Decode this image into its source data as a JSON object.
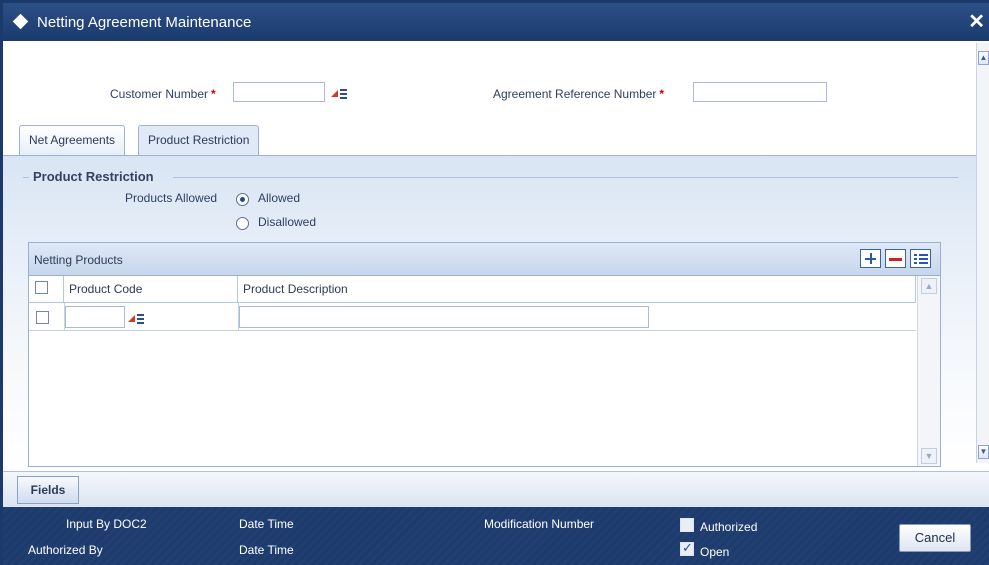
{
  "window": {
    "title": "Netting Agreement Maintenance",
    "close_icon": "close-icon"
  },
  "header": {
    "customer_number_label": "Customer Number",
    "customer_number_value": "",
    "agreement_ref_label": "Agreement Reference Number",
    "agreement_ref_value": "",
    "required_marker": "*"
  },
  "tabs": [
    {
      "label": "Net Agreements",
      "active": false
    },
    {
      "label": "Product Restriction",
      "active": true
    }
  ],
  "product_restriction": {
    "section_title": "Product Restriction",
    "products_allowed_label": "Products Allowed",
    "options": [
      {
        "label": "Allowed",
        "selected": true
      },
      {
        "label": "Disallowed",
        "selected": false
      }
    ]
  },
  "grid": {
    "title": "Netting Products",
    "columns": [
      "Product Code",
      "Product Description"
    ],
    "rows": [
      {
        "product_code": "",
        "product_description": ""
      }
    ],
    "buttons": [
      "add-row-icon",
      "delete-row-icon",
      "view-rows-icon"
    ]
  },
  "fields_button": "Fields",
  "footer": {
    "input_by_label": "Input By",
    "input_by_value": "DOC2",
    "authorized_by_label": "Authorized By",
    "date_time_label_1": "Date Time",
    "date_time_label_2": "Date Time",
    "modification_number_label": "Modification Number",
    "authorized_label": "Authorized",
    "authorized_checked": false,
    "open_label": "Open",
    "open_checked": true,
    "cancel_label": "Cancel"
  },
  "colors": {
    "titlebar": "#1b3b6e",
    "required": "#d40000",
    "footer": "#1d3c6c"
  }
}
